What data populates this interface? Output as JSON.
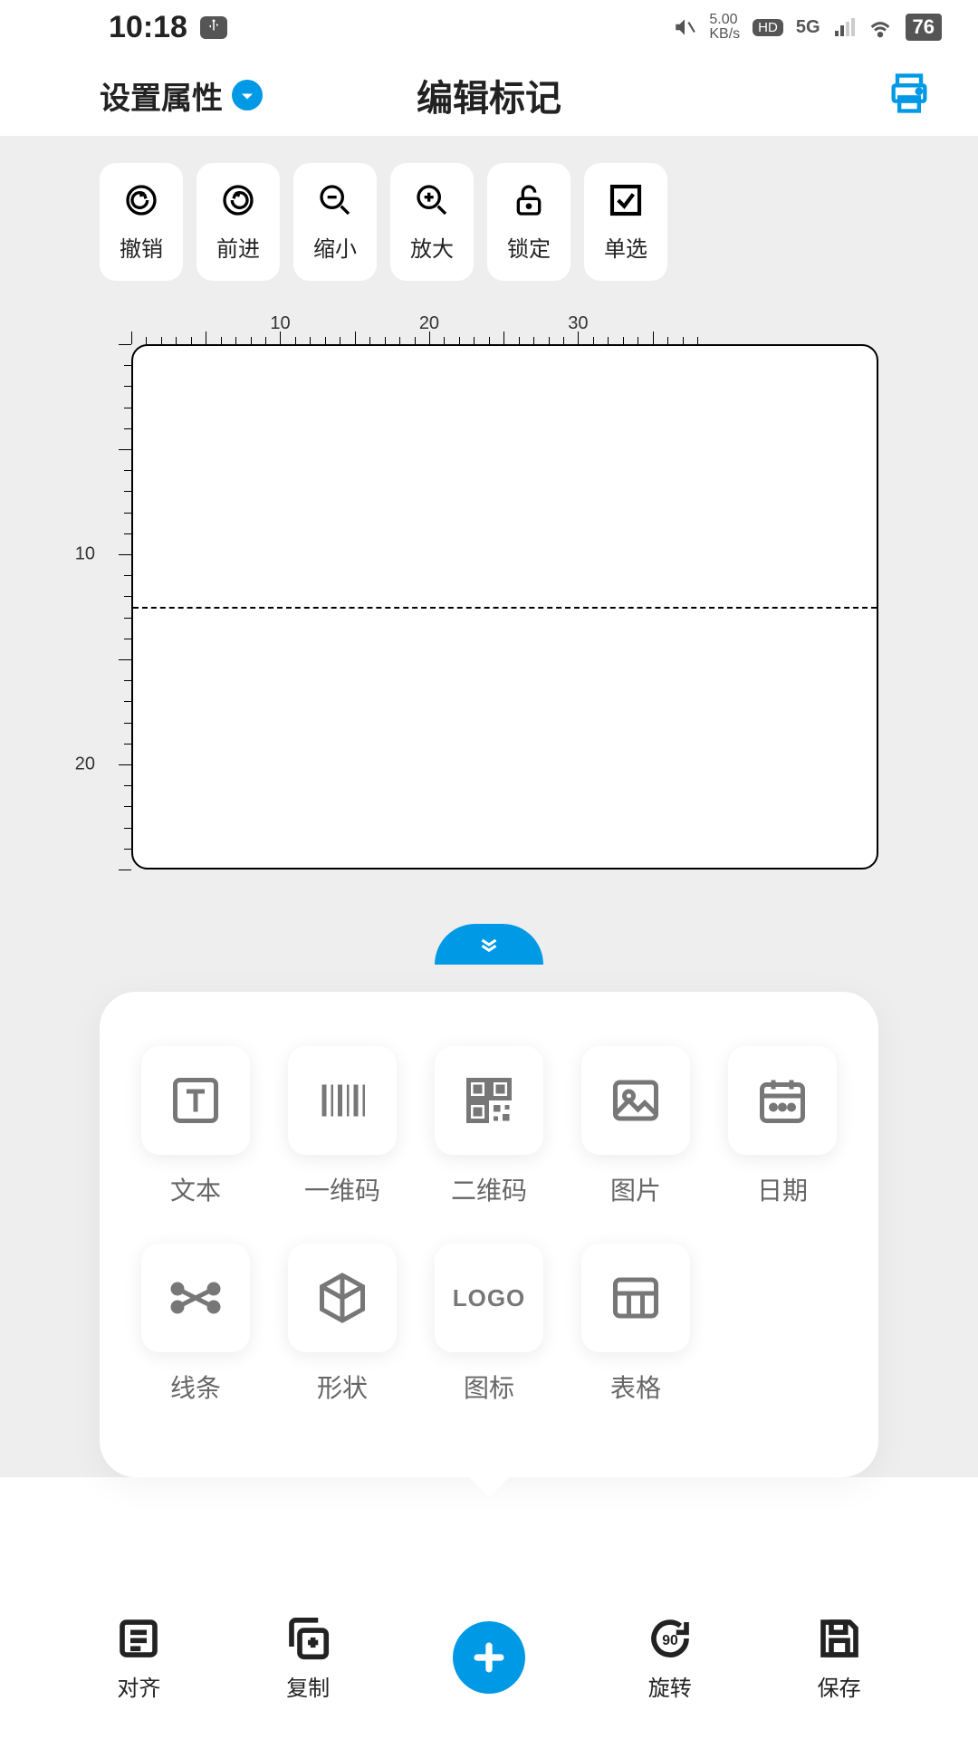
{
  "status": {
    "time": "10:18",
    "net_speed": "5.00",
    "net_unit": "KB/s",
    "hd": "HD",
    "net_type": "5G",
    "battery": "76"
  },
  "header": {
    "left_label": "设置属性",
    "title": "编辑标记"
  },
  "toolbar": {
    "undo": "撤销",
    "redo": "前进",
    "zoom_out": "缩小",
    "zoom_in": "放大",
    "lock": "锁定",
    "single": "单选"
  },
  "ruler": {
    "top_marks": [
      "10",
      "20",
      "30"
    ],
    "left_marks": [
      "10",
      "20"
    ]
  },
  "elements": {
    "text": "文本",
    "barcode": "一维码",
    "qrcode": "二维码",
    "image": "图片",
    "date": "日期",
    "line": "线条",
    "shape": "形状",
    "logo": "图标",
    "logo_text": "LOGO",
    "table": "表格"
  },
  "bottom": {
    "align": "对齐",
    "copy": "复制",
    "rotate": "旋转",
    "save": "保存"
  }
}
